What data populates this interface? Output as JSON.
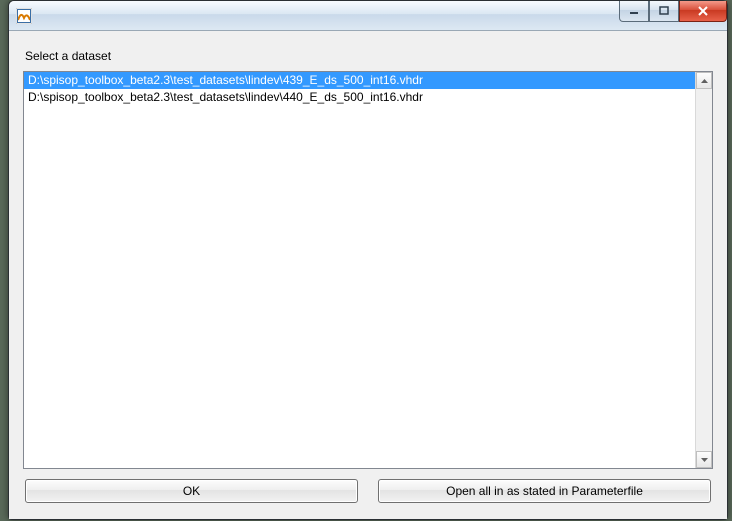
{
  "window": {
    "title": ""
  },
  "label": "Select a dataset",
  "list": {
    "items": [
      "D:\\spisop_toolbox_beta2.3\\test_datasets\\lindev\\439_E_ds_500_int16.vhdr",
      "D:\\spisop_toolbox_beta2.3\\test_datasets\\lindev\\440_E_ds_500_int16.vhdr"
    ],
    "selected_index": 0
  },
  "buttons": {
    "ok": "OK",
    "open_all": "Open all in as stated in Parameterfile"
  }
}
